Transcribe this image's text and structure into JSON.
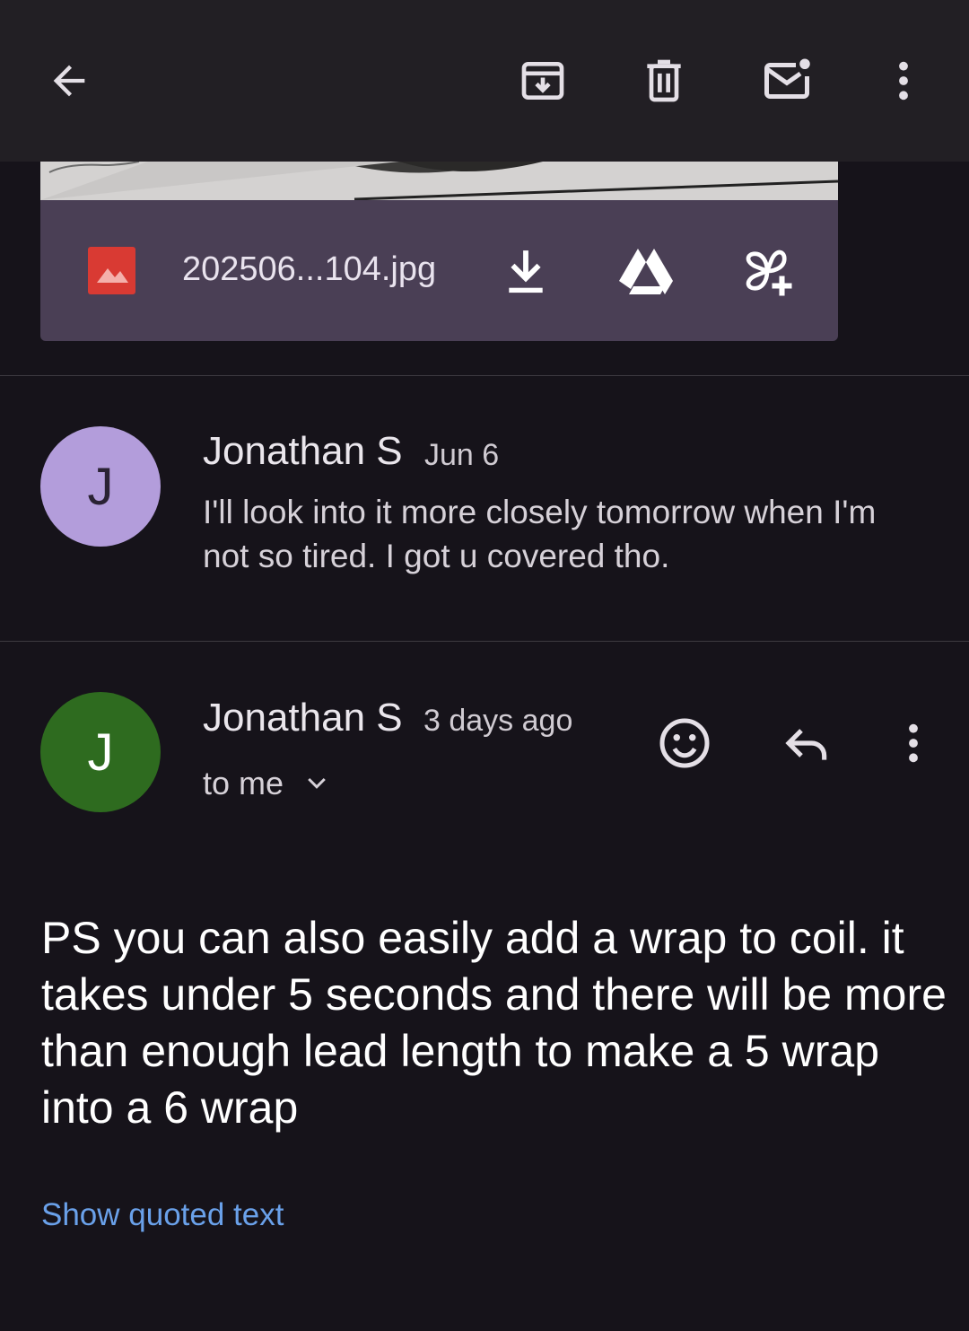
{
  "toolbar": {
    "back_icon": "arrow-left-icon",
    "archive_icon": "archive-icon",
    "delete_icon": "trash-icon",
    "mark_unread_icon": "mail-unread-icon",
    "more_icon": "more-vert-icon"
  },
  "attachment": {
    "file_name": "202506...104.jpg",
    "type_icon": "image-icon",
    "actions": [
      "download-icon",
      "drive-icon",
      "add-to-photos-icon"
    ],
    "file_icon_color": "#d93a33"
  },
  "messages": [
    {
      "avatar_letter": "J",
      "avatar_color": "#b39ddb",
      "sender": "Jonathan S",
      "date": "Jun 6",
      "snippet": "I'll look into it more closely tomorrow when I'm not so tired. I got u covered tho."
    },
    {
      "avatar_letter": "J",
      "avatar_color": "#2e6b1f",
      "sender": "Jonathan S",
      "date": "3 days ago",
      "recipient": "to me",
      "body": "PS you can also easily add a wrap to coil. it takes under 5 seconds and there will be more than enough lead length to make a 5 wrap into a 6 wrap",
      "show_quoted": "Show quoted text"
    }
  ],
  "colors": {
    "background": "#16131a",
    "toolbar": "#221f24",
    "attachment_bar": "#4a3f55",
    "link": "#6aa1ea"
  }
}
